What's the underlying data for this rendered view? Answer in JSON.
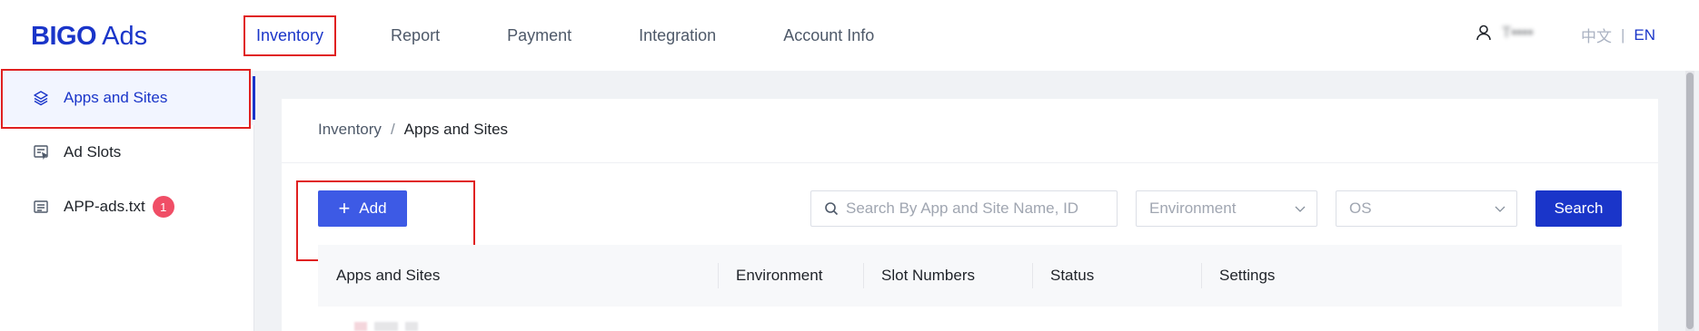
{
  "brand": {
    "name_bold": "BIGO",
    "name_light": "Ads",
    "color": "#1a35c9"
  },
  "nav": {
    "items": [
      {
        "label": "Inventory",
        "active": true
      },
      {
        "label": "Report"
      },
      {
        "label": "Payment"
      },
      {
        "label": "Integration"
      },
      {
        "label": "Account Info"
      }
    ]
  },
  "user": {
    "icon": "user-icon",
    "name": "T▪▪▪▪"
  },
  "lang": {
    "zh": "中文",
    "sep": "|",
    "en": "EN"
  },
  "sidebar": {
    "items": [
      {
        "label": "Apps and Sites",
        "icon": "layers-icon",
        "active": true
      },
      {
        "label": "Ad Slots",
        "icon": "ad-slot-icon"
      },
      {
        "label": "APP-ads.txt",
        "icon": "document-icon",
        "badge": "1"
      }
    ]
  },
  "breadcrumb": {
    "root": "Inventory",
    "sep": "/",
    "current": "Apps and Sites"
  },
  "toolbar": {
    "add_label": "Add",
    "search_placeholder": "Search By App and Site Name, ID",
    "environment_placeholder": "Environment",
    "os_placeholder": "OS",
    "search_label": "Search"
  },
  "table": {
    "columns": [
      "Apps and Sites",
      "Environment",
      "Slot Numbers",
      "Status",
      "Settings"
    ]
  },
  "colors": {
    "accent": "#1a35c9",
    "primary_button": "#3d5ae5",
    "badge": "#f04e66",
    "highlight": "#e02020"
  }
}
